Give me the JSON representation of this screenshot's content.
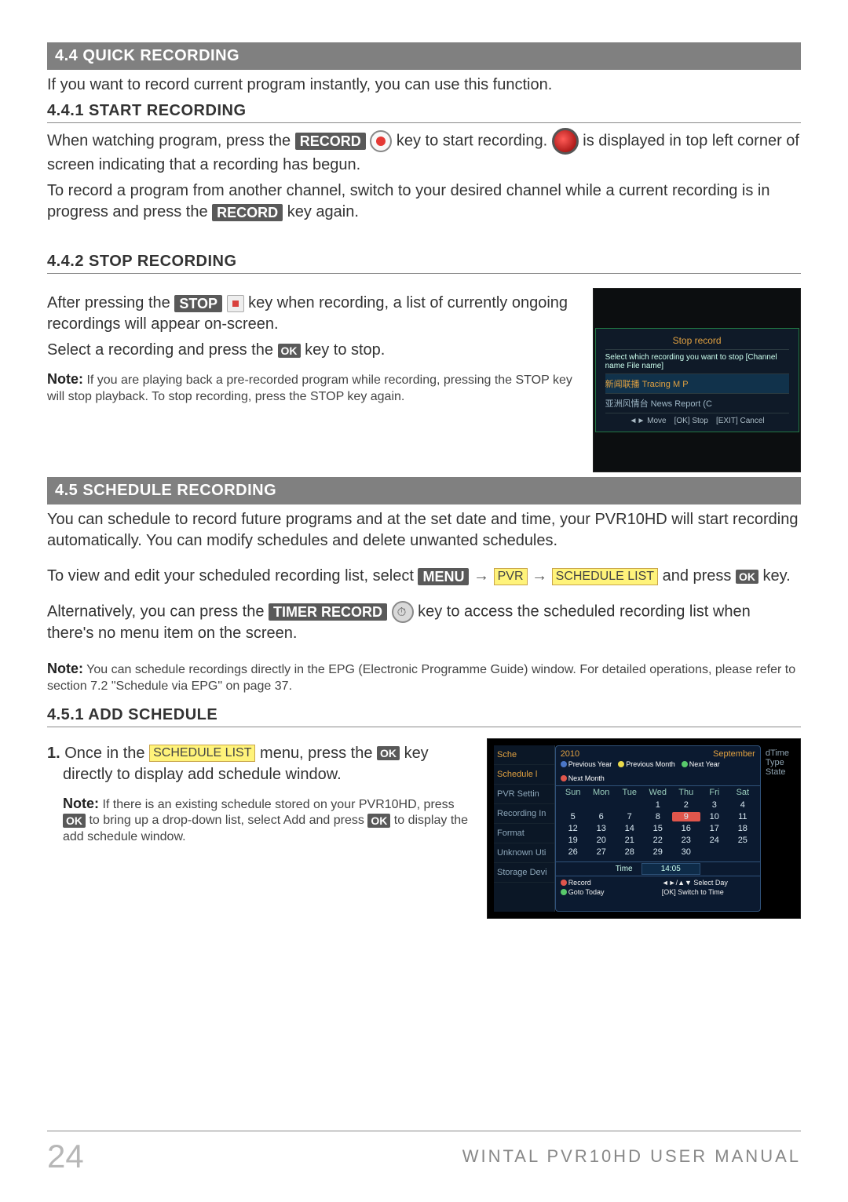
{
  "sec44": "4.4 QUICK RECORDING",
  "sec44_body": "If you want to record current program instantly, you can use this function.",
  "sec441": "4.4.1 START RECORDING",
  "s441_t1": "When watching program, press the ",
  "s441_record": "RECORD",
  "s441_t2": " key to start recording. ",
  "s441_t3": " is displayed in top left corner of screen indicating that a recording has begun.",
  "s441_t4": "To record a program from another channel, switch to your desired channel while a current recording is in progress and press the ",
  "s441_t5": " key again.",
  "sec442": "4.4.2 STOP RECORDING",
  "s442_t1": "After pressing the ",
  "s442_stop": "STOP",
  "s442_t2": " key when recording, a list of currently ongoing recordings will appear on-screen.",
  "s442_t3": "Select a recording and press the ",
  "s442_ok": "OK",
  "s442_t4": " key to stop.",
  "s442_note_b": "Note:",
  "s442_note": " If you are playing back a pre-recorded program while recording, pressing the STOP key will stop playback. To stop recording, press the STOP key again.",
  "stoprec": {
    "title": "Stop record",
    "prompt": "Select which recording you want to stop  [Channel name  File name]",
    "row1": "新闻联播  Tracing M P",
    "row2": "亚洲风情台  News Report (C",
    "foot_move": "◄► Move",
    "foot_ok": "[OK]  Stop",
    "foot_exit": "[EXIT]  Cancel"
  },
  "sec45": "4.5 SCHEDULE RECORDING",
  "s45_t1": "You can schedule to record future programs and at the set date and time, your PVR10HD will start recording automatically. You can modify schedules and delete unwanted schedules.",
  "s45_t2a": "To view and edit your scheduled recording list, select ",
  "s45_menu": "MENU",
  "s45_pvr": "PVR",
  "s45_slist": "SCHEDULE LIST",
  "s45_t2b": " and press ",
  "s45_t2c": " key.",
  "s45_t3a": "Alternatively, you can press the ",
  "s45_timer": "TIMER RECORD",
  "s45_t3b": " key to access the scheduled recording list when there's no menu item on the screen.",
  "s45_note_b": "Note:",
  "s45_note": " You can schedule recordings directly in the EPG (Electronic Programme Guide) window. For detailed operations, please refer to section 7.2 \"Schedule via EPG\" on page 37.",
  "sec451": "4.5.1 ADD SCHEDULE",
  "s451_1a": "1.",
  "s451_1b": " Once in the ",
  "s451_1c": " menu, press the ",
  "s451_1d": " key directly to display add schedule window.",
  "s451_note_b": "Note:",
  "s451_note_a": " If there is an existing schedule stored on your PVR10HD, press ",
  "s451_note_b2": " to bring up a drop-down list, select  Add  and press ",
  "s451_note_c": " to display the add schedule window.",
  "cal": {
    "sidebar_title": "Sche",
    "sidebar_sub": "Schedule l",
    "side_items": [
      "PVR Settin",
      "Recording In",
      "Format",
      "Unknown Uti",
      "Storage Devi"
    ],
    "right_cols": "dTime    Type    State",
    "year": "2010",
    "month": "September",
    "keys": {
      "prev_year": "Previous Year",
      "next_year": "Next Year",
      "prev_month": "Previous Month",
      "next_month": "Next Month"
    },
    "days": [
      "Sun",
      "Mon",
      "Tue",
      "Wed",
      "Thu",
      "Fri",
      "Sat"
    ],
    "dates": [
      "",
      "",
      "",
      "1",
      "2",
      "3",
      "4",
      "5",
      "6",
      "7",
      "8",
      "9",
      "10",
      "11",
      "12",
      "13",
      "14",
      "15",
      "16",
      "17",
      "18",
      "19",
      "20",
      "21",
      "22",
      "23",
      "24",
      "25",
      "26",
      "27",
      "28",
      "29",
      "30",
      "",
      ""
    ],
    "selected": "9",
    "time_label": "Time",
    "time_val": "14:05",
    "foot": {
      "record": "Record",
      "today": "Goto Today",
      "selday": "◄►/▲▼ Select Day",
      "swtime": "[OK] Switch to Time"
    }
  },
  "page_no": "24",
  "footer": "WINTAL PVR10HD USER MANUAL"
}
